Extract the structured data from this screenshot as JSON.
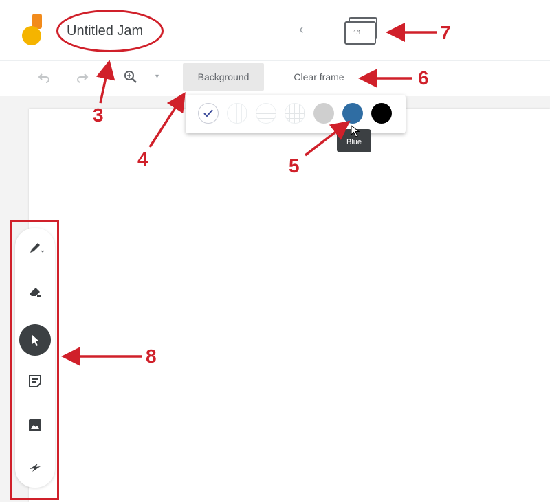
{
  "header": {
    "title": "Untitled Jam",
    "frame_counter": "1/1",
    "brand_colors": {
      "logo_yellow": "#f5b400",
      "logo_orange": "#f28b1c"
    }
  },
  "toolbar": {
    "background_label": "Background",
    "clear_frame_label": "Clear frame"
  },
  "background_popup": {
    "swatches": [
      {
        "name": "Blank",
        "selected": true,
        "color": "#ffffff"
      },
      {
        "name": "Dotted",
        "color": "#ffffff"
      },
      {
        "name": "Ruled",
        "color": "#ffffff"
      },
      {
        "name": "Grid",
        "color": "#ffffff"
      },
      {
        "name": "Gray",
        "color": "#cfcfcf"
      },
      {
        "name": "Blue",
        "color": "#2f6da3"
      },
      {
        "name": "Black",
        "color": "#000000"
      }
    ],
    "tooltip": "Blue"
  },
  "tools": [
    {
      "name": "pen",
      "icon": "pen-icon"
    },
    {
      "name": "eraser",
      "icon": "eraser-icon"
    },
    {
      "name": "select",
      "icon": "pointer-icon",
      "active": true
    },
    {
      "name": "sticky note",
      "icon": "sticky-note-icon"
    },
    {
      "name": "add image",
      "icon": "image-icon"
    },
    {
      "name": "laser",
      "icon": "laser-icon"
    }
  ],
  "annotations": {
    "label_3": "3",
    "label_4": "4",
    "label_5": "5",
    "label_6": "6",
    "label_7": "7",
    "label_8": "8",
    "color": "#d0202a"
  }
}
